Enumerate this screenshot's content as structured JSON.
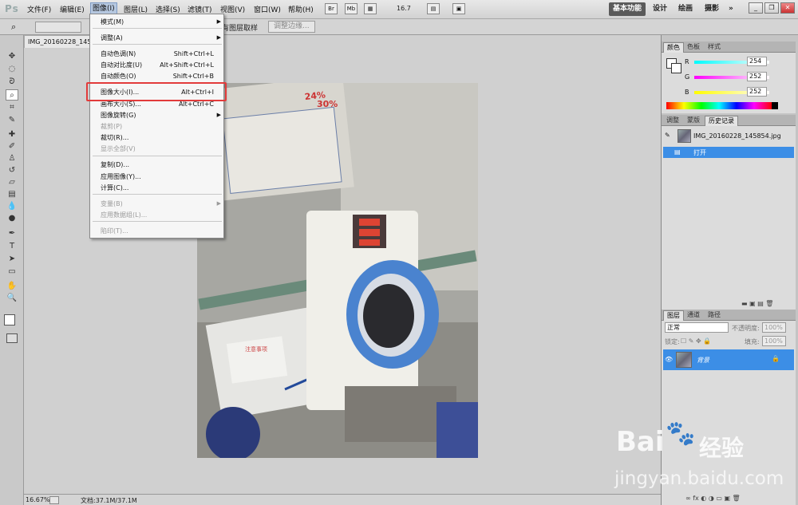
{
  "app": {
    "logo": "Ps"
  },
  "menubar": {
    "items": [
      "文件(F)",
      "编辑(E)",
      "图像(I)",
      "图层(L)",
      "选择(S)",
      "滤镜(T)",
      "视图(V)",
      "窗口(W)",
      "帮助(H)"
    ],
    "icon_br": "Br",
    "icon_mb": "Mb",
    "zoom": "16.7",
    "workspaces": [
      "基本功能",
      "设计",
      "绘画",
      "摄影"
    ],
    "more": "»"
  },
  "options": {
    "tail_text": "有图层取样",
    "refine_edge": "调整边缘..."
  },
  "document": {
    "tab_title": "IMG_20160228_145",
    "zoom_percent": "16.67%",
    "doc_size": "文档:37.1M/37.1M"
  },
  "image_menu": {
    "items": [
      {
        "label": "模式(M)",
        "shortcut": "",
        "submenu": true,
        "disabled": false
      },
      {
        "label": "调整(A)",
        "shortcut": "",
        "submenu": true,
        "disabled": false
      },
      {
        "label": "自动色调(N)",
        "shortcut": "Shift+Ctrl+L",
        "submenu": false,
        "disabled": false
      },
      {
        "label": "自动对比度(U)",
        "shortcut": "Alt+Shift+Ctrl+L",
        "submenu": false,
        "disabled": false
      },
      {
        "label": "自动颜色(O)",
        "shortcut": "Shift+Ctrl+B",
        "submenu": false,
        "disabled": false
      },
      {
        "label": "图像大小(I)...",
        "shortcut": "Alt+Ctrl+I",
        "submenu": false,
        "disabled": false
      },
      {
        "label": "画布大小(S)...",
        "shortcut": "Alt+Ctrl+C",
        "submenu": false,
        "disabled": false
      },
      {
        "label": "图像旋转(G)",
        "shortcut": "",
        "submenu": true,
        "disabled": false
      },
      {
        "label": "裁剪(P)",
        "shortcut": "",
        "submenu": false,
        "disabled": true
      },
      {
        "label": "裁切(R)...",
        "shortcut": "",
        "submenu": false,
        "disabled": false
      },
      {
        "label": "显示全部(V)",
        "shortcut": "",
        "submenu": false,
        "disabled": true
      },
      {
        "label": "复制(D)...",
        "shortcut": "",
        "submenu": false,
        "disabled": false
      },
      {
        "label": "应用图像(Y)...",
        "shortcut": "",
        "submenu": false,
        "disabled": false
      },
      {
        "label": "计算(C)...",
        "shortcut": "",
        "submenu": false,
        "disabled": false
      },
      {
        "label": "变量(B)",
        "shortcut": "",
        "submenu": true,
        "disabled": true
      },
      {
        "label": "应用数据组(L)...",
        "shortcut": "",
        "submenu": false,
        "disabled": true
      },
      {
        "label": "陷印(T)...",
        "shortcut": "",
        "submenu": false,
        "disabled": true
      }
    ]
  },
  "color_panel": {
    "tabs": [
      "颜色",
      "色板",
      "样式"
    ],
    "r_label": "R",
    "g_label": "G",
    "b_label": "B",
    "r": "254",
    "g": "252",
    "b": "252"
  },
  "history_panel": {
    "tabs": [
      "调整",
      "蒙版",
      "历史记录"
    ],
    "snapshot_name": "IMG_20160228_145854.jpg",
    "state": "打开"
  },
  "layers_panel": {
    "tabs": [
      "图层",
      "通道",
      "路径"
    ],
    "blend_mode": "正常",
    "opacity_label": "不透明度:",
    "opacity": "100%",
    "lock_label": "锁定:",
    "fill_label": "填充:",
    "fill": "100%",
    "layer_name": "背景"
  },
  "photo_poster": {
    "headline": "24%",
    "headline2": "30%",
    "note": "注意事项"
  },
  "watermark": {
    "brand": "Bai",
    "brand2": "经验",
    "url": "jingyan.baidu.com"
  }
}
